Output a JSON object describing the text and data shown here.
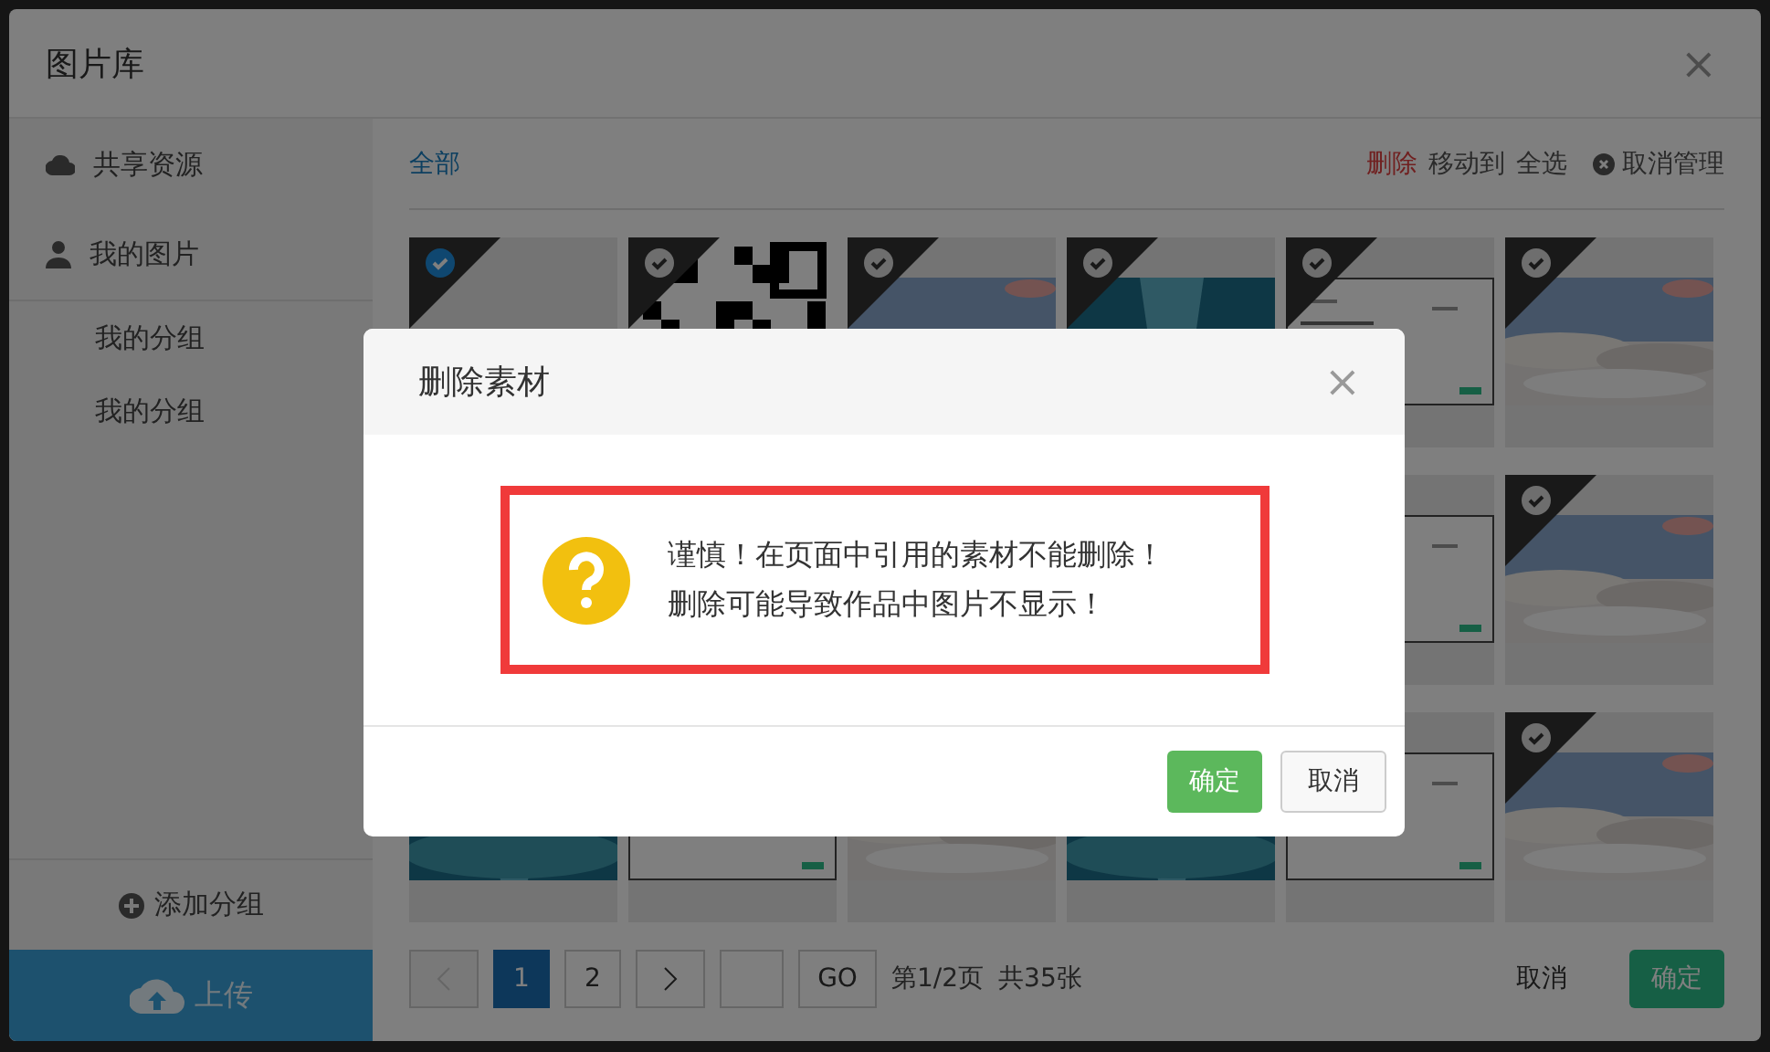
{
  "window": {
    "title": "图片库",
    "close": "×"
  },
  "sidebar": {
    "items": [
      {
        "kind": "cloud",
        "label": "共享资源"
      },
      {
        "kind": "user",
        "label": "我的图片"
      }
    ],
    "groups": [
      "我的分组",
      "我的分组"
    ],
    "add_group": "添加分组",
    "upload": "上传"
  },
  "toolbar": {
    "filter": "全部",
    "delete": "删除",
    "move": "移动到",
    "select_all": "全选",
    "cancel_manage": "取消管理"
  },
  "tiles": [
    {
      "kind": "blank",
      "selected": true
    },
    {
      "kind": "qr",
      "selected": false
    },
    {
      "kind": "sky",
      "selected": false
    },
    {
      "kind": "ocean",
      "selected": false
    },
    {
      "kind": "doc",
      "selected": false
    },
    {
      "kind": "sky",
      "selected": false
    },
    {
      "kind": "hidden"
    },
    {
      "kind": "hidden"
    },
    {
      "kind": "hidden"
    },
    {
      "kind": "hidden"
    },
    {
      "kind": "doc"
    },
    {
      "kind": "sky",
      "selected": false
    },
    {
      "kind": "ocean"
    },
    {
      "kind": "doc"
    },
    {
      "kind": "sky"
    },
    {
      "kind": "ocean"
    },
    {
      "kind": "doc"
    },
    {
      "kind": "sky",
      "selected": false
    }
  ],
  "pagination": {
    "pages": [
      {
        "label": "1",
        "selected": true
      },
      {
        "label": "2",
        "selected": false
      }
    ],
    "prev_disabled": true,
    "go": "GO",
    "page_info": "第1/2页",
    "total": "共35张"
  },
  "footer": {
    "cancel": "取消",
    "confirm": "确定"
  },
  "dialog": {
    "title": "删除素材",
    "close": "×",
    "lines": [
      "谨慎！在页面中引用的素材不能删除！",
      "删除可能导致作品中图片不显示！"
    ],
    "confirm": "确定",
    "cancel": "取消"
  }
}
